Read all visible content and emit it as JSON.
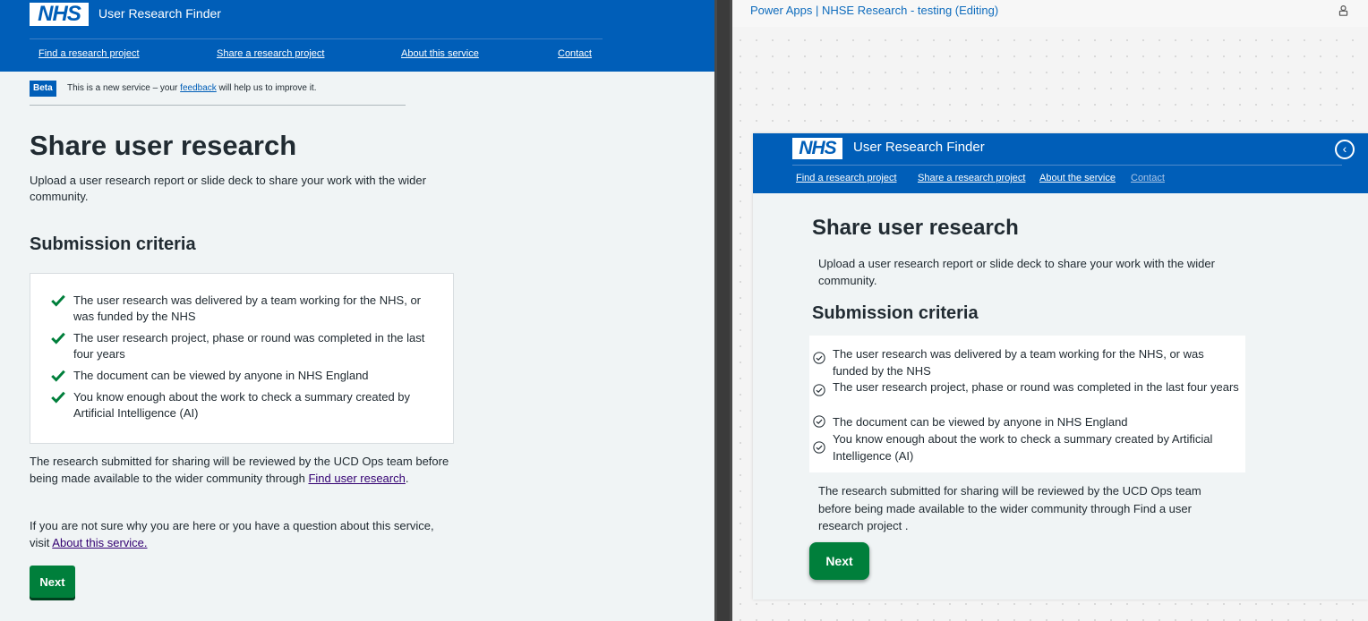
{
  "left": {
    "header": {
      "logo": "NHS",
      "service_name": "User Research Finder",
      "nav": [
        "Find a research project",
        "Share a research project",
        "About this service",
        "Contact"
      ]
    },
    "beta": {
      "tag": "Beta",
      "text_before": "This is a new service – your ",
      "link": "feedback",
      "text_after": " will help us to improve it."
    },
    "title": "Share user research",
    "intro": "Upload a user research report or slide deck to share your work with the wider community.",
    "criteria_heading": "Submission criteria",
    "criteria": [
      "The user research was delivered by a team working for the NHS, or was funded by the NHS",
      "The user research project, phase or round was completed in the last four years",
      "The document can be viewed by anyone in NHS England",
      "You know enough about the work to check a summary created by Artificial Intelligence (AI)"
    ],
    "review_note_before": "The research submitted for sharing will be reviewed by the UCD Ops team before being made available to the wider community through ",
    "review_note_link": "Find user research",
    "review_note_after": ".",
    "help_before": "If you are not sure why you are here or you have a question about this service, visit ",
    "help_link": "About this service.",
    "next_label": "Next",
    "colors": {
      "header": "#005eb8",
      "tick": "#007f3b",
      "button": "#007f3b"
    }
  },
  "right": {
    "topbar": {
      "text": "Power Apps  |  NHSE Research - testing (Editing)",
      "icon": "user-lock-icon"
    },
    "header": {
      "logo": "NHS",
      "service_name": "User Research Finder",
      "back_icon": "chevron-left-circle-icon",
      "nav": [
        "Find a research project",
        "Share a research project",
        "About the service",
        "Contact"
      ]
    },
    "title": "Share user research",
    "intro": "Upload a user research report or slide deck to share your work with the wider community.",
    "criteria_heading": "Submission criteria",
    "criteria": [
      "The user research was delivered by a team working for the NHS, or was funded by the NHS",
      "The user research project, phase or round was completed in the last four years",
      "The document can be viewed by anyone in NHS England",
      "You know enough about the work to check a summary created by Artificial Intelligence (AI)"
    ],
    "review_note": "The research submitted for sharing will be reviewed by the UCD Ops team before being made available to the wider community through Find a user research project .",
    "next_label": "Next"
  }
}
